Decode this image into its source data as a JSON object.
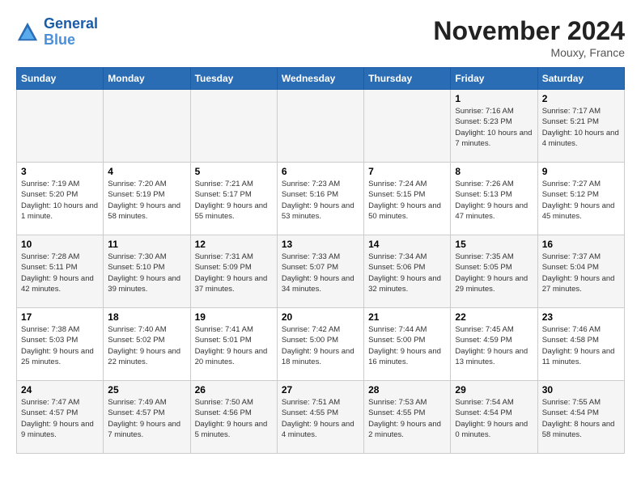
{
  "header": {
    "logo_line1": "General",
    "logo_line2": "Blue",
    "month": "November 2024",
    "location": "Mouxy, France"
  },
  "days_of_week": [
    "Sunday",
    "Monday",
    "Tuesday",
    "Wednesday",
    "Thursday",
    "Friday",
    "Saturday"
  ],
  "weeks": [
    [
      {
        "day": "",
        "info": ""
      },
      {
        "day": "",
        "info": ""
      },
      {
        "day": "",
        "info": ""
      },
      {
        "day": "",
        "info": ""
      },
      {
        "day": "",
        "info": ""
      },
      {
        "day": "1",
        "info": "Sunrise: 7:16 AM\nSunset: 5:23 PM\nDaylight: 10 hours and 7 minutes."
      },
      {
        "day": "2",
        "info": "Sunrise: 7:17 AM\nSunset: 5:21 PM\nDaylight: 10 hours and 4 minutes."
      }
    ],
    [
      {
        "day": "3",
        "info": "Sunrise: 7:19 AM\nSunset: 5:20 PM\nDaylight: 10 hours and 1 minute."
      },
      {
        "day": "4",
        "info": "Sunrise: 7:20 AM\nSunset: 5:19 PM\nDaylight: 9 hours and 58 minutes."
      },
      {
        "day": "5",
        "info": "Sunrise: 7:21 AM\nSunset: 5:17 PM\nDaylight: 9 hours and 55 minutes."
      },
      {
        "day": "6",
        "info": "Sunrise: 7:23 AM\nSunset: 5:16 PM\nDaylight: 9 hours and 53 minutes."
      },
      {
        "day": "7",
        "info": "Sunrise: 7:24 AM\nSunset: 5:15 PM\nDaylight: 9 hours and 50 minutes."
      },
      {
        "day": "8",
        "info": "Sunrise: 7:26 AM\nSunset: 5:13 PM\nDaylight: 9 hours and 47 minutes."
      },
      {
        "day": "9",
        "info": "Sunrise: 7:27 AM\nSunset: 5:12 PM\nDaylight: 9 hours and 45 minutes."
      }
    ],
    [
      {
        "day": "10",
        "info": "Sunrise: 7:28 AM\nSunset: 5:11 PM\nDaylight: 9 hours and 42 minutes."
      },
      {
        "day": "11",
        "info": "Sunrise: 7:30 AM\nSunset: 5:10 PM\nDaylight: 9 hours and 39 minutes."
      },
      {
        "day": "12",
        "info": "Sunrise: 7:31 AM\nSunset: 5:09 PM\nDaylight: 9 hours and 37 minutes."
      },
      {
        "day": "13",
        "info": "Sunrise: 7:33 AM\nSunset: 5:07 PM\nDaylight: 9 hours and 34 minutes."
      },
      {
        "day": "14",
        "info": "Sunrise: 7:34 AM\nSunset: 5:06 PM\nDaylight: 9 hours and 32 minutes."
      },
      {
        "day": "15",
        "info": "Sunrise: 7:35 AM\nSunset: 5:05 PM\nDaylight: 9 hours and 29 minutes."
      },
      {
        "day": "16",
        "info": "Sunrise: 7:37 AM\nSunset: 5:04 PM\nDaylight: 9 hours and 27 minutes."
      }
    ],
    [
      {
        "day": "17",
        "info": "Sunrise: 7:38 AM\nSunset: 5:03 PM\nDaylight: 9 hours and 25 minutes."
      },
      {
        "day": "18",
        "info": "Sunrise: 7:40 AM\nSunset: 5:02 PM\nDaylight: 9 hours and 22 minutes."
      },
      {
        "day": "19",
        "info": "Sunrise: 7:41 AM\nSunset: 5:01 PM\nDaylight: 9 hours and 20 minutes."
      },
      {
        "day": "20",
        "info": "Sunrise: 7:42 AM\nSunset: 5:00 PM\nDaylight: 9 hours and 18 minutes."
      },
      {
        "day": "21",
        "info": "Sunrise: 7:44 AM\nSunset: 5:00 PM\nDaylight: 9 hours and 16 minutes."
      },
      {
        "day": "22",
        "info": "Sunrise: 7:45 AM\nSunset: 4:59 PM\nDaylight: 9 hours and 13 minutes."
      },
      {
        "day": "23",
        "info": "Sunrise: 7:46 AM\nSunset: 4:58 PM\nDaylight: 9 hours and 11 minutes."
      }
    ],
    [
      {
        "day": "24",
        "info": "Sunrise: 7:47 AM\nSunset: 4:57 PM\nDaylight: 9 hours and 9 minutes."
      },
      {
        "day": "25",
        "info": "Sunrise: 7:49 AM\nSunset: 4:57 PM\nDaylight: 9 hours and 7 minutes."
      },
      {
        "day": "26",
        "info": "Sunrise: 7:50 AM\nSunset: 4:56 PM\nDaylight: 9 hours and 5 minutes."
      },
      {
        "day": "27",
        "info": "Sunrise: 7:51 AM\nSunset: 4:55 PM\nDaylight: 9 hours and 4 minutes."
      },
      {
        "day": "28",
        "info": "Sunrise: 7:53 AM\nSunset: 4:55 PM\nDaylight: 9 hours and 2 minutes."
      },
      {
        "day": "29",
        "info": "Sunrise: 7:54 AM\nSunset: 4:54 PM\nDaylight: 9 hours and 0 minutes."
      },
      {
        "day": "30",
        "info": "Sunrise: 7:55 AM\nSunset: 4:54 PM\nDaylight: 8 hours and 58 minutes."
      }
    ]
  ]
}
